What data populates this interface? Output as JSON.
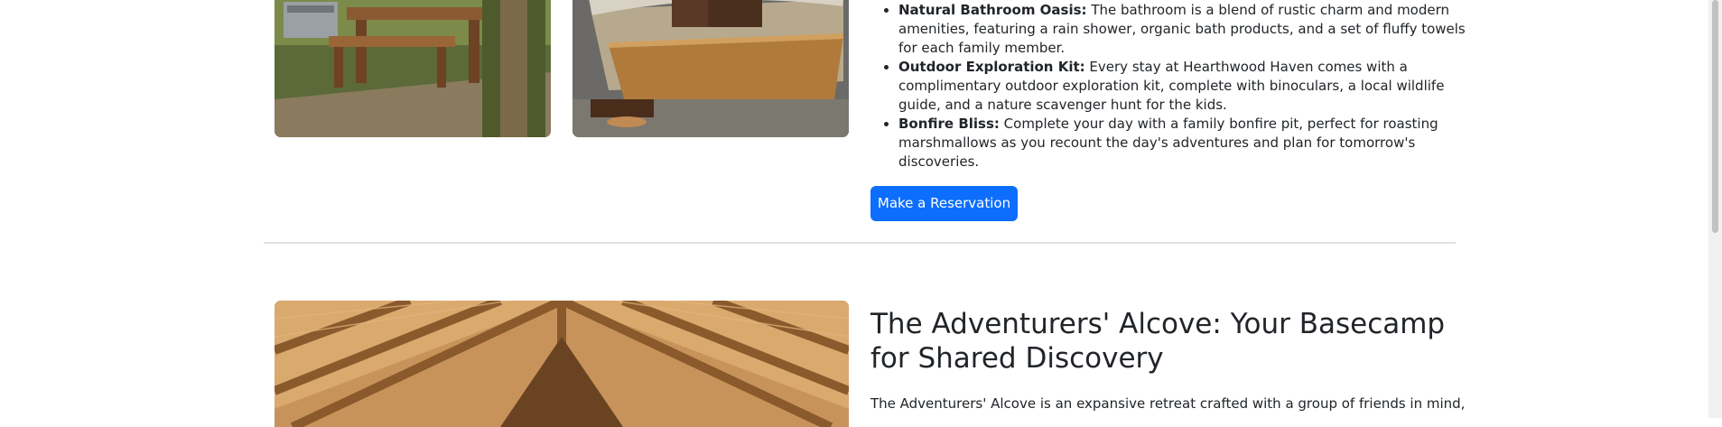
{
  "images": {
    "picnic": "picnic-table-grill-photo",
    "basket": "smores-chocolate-basket-photo",
    "roof": "wooden-roof-rafters-photo"
  },
  "amenities": [
    {
      "title": "Natural Bathroom Oasis:",
      "text": " The bathroom is a blend of rustic charm and modern amenities, featuring a rain shower, organic bath products, and a set of fluffy towels for each family member."
    },
    {
      "title": "Outdoor Exploration Kit:",
      "text": " Every stay at Hearthwood Haven comes with a complimentary outdoor exploration kit, complete with binoculars, a local wildlife guide, and a nature scavenger hunt for the kids."
    },
    {
      "title": "Bonfire Bliss:",
      "text": " Complete your day with a family bonfire pit, perfect for roasting marshmallows as you recount the day's adventures and plan for tomorrow's discoveries."
    }
  ],
  "reservation_button": "Make a Reservation",
  "section2": {
    "heading": "The Adventurers' Alcove: Your Basecamp for Shared Discovery",
    "intro": "The Adventurers' Alcove is an expansive retreat crafted with a group of friends in mind,"
  },
  "colors": {
    "primary": "#0d6efd",
    "divider": "#dee2e6",
    "text": "#212529"
  }
}
